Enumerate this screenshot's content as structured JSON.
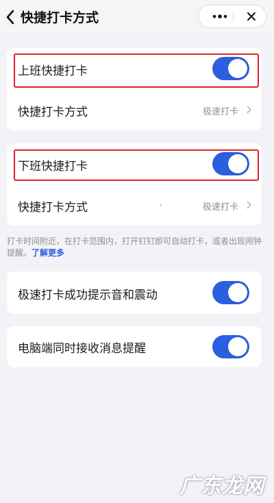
{
  "header": {
    "title": "快捷打卡方式",
    "back_icon": "chevron-left-icon",
    "more_icon": "more-dots-icon",
    "close_icon": "close-icon"
  },
  "clock_in_card": {
    "toggle_label": "上班快捷打卡",
    "toggle_on": true,
    "method_label": "快捷打卡方式",
    "method_value": "极速打卡"
  },
  "clock_out_card": {
    "toggle_label": "下班快捷打卡",
    "toggle_on": true,
    "method_label": "快捷打卡方式",
    "method_value": "极速打卡"
  },
  "footnote": {
    "text": "打卡时间附近，在打卡范围内，打开钉钉即可自动打卡，或者出现闹钟提醒。",
    "link": "了解更多"
  },
  "settings": [
    {
      "label": "极速打卡成功提示音和震动",
      "toggle_on": true
    },
    {
      "label": "电脑端同时接收消息提醒",
      "toggle_on": true
    }
  ],
  "watermark": "广东龙网",
  "colors": {
    "accent": "#2b5fe0",
    "highlight": "#e0202a",
    "background": "#f2f2f7"
  }
}
